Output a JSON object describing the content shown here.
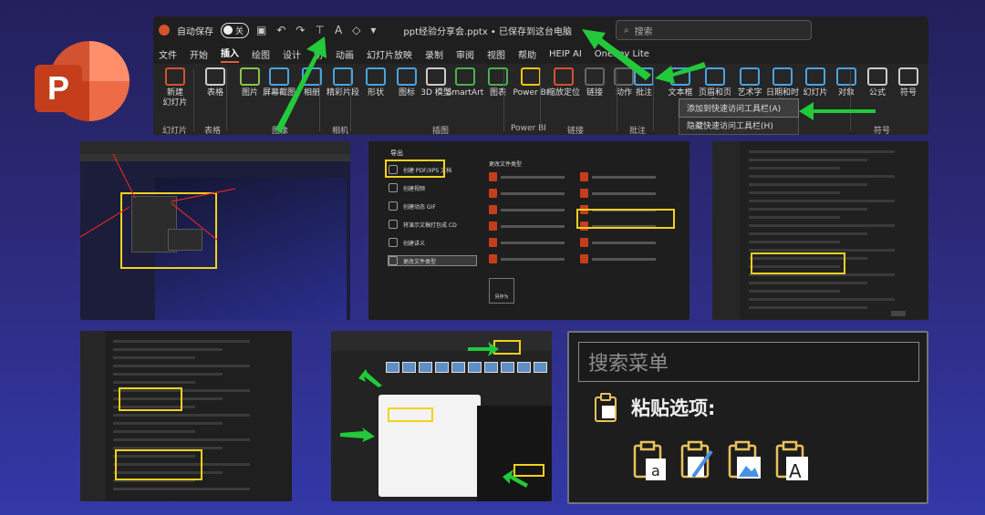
{
  "ribbon": {
    "autosave_label": "自动保存",
    "autosave_state": "关",
    "doc_title": "ppt经验分享会.pptx • 已保存到这台电脑",
    "search_placeholder": "搜索",
    "tabs": [
      "文件",
      "开始",
      "插入",
      "绘图",
      "设计",
      "切",
      "动画",
      "幻灯片放映",
      "录制",
      "审阅",
      "视图",
      "帮助",
      "HEIP AI",
      "OneKey Lite"
    ],
    "active_tab": "插入",
    "buttons": [
      {
        "label": "新建\n幻灯片",
        "icon": "new-slide-icon"
      },
      {
        "label": "表格",
        "icon": "table-icon"
      },
      {
        "label": "图片",
        "icon": "picture-icon"
      },
      {
        "label": "屏幕截图",
        "icon": "screenshot-icon"
      },
      {
        "label": "相册",
        "icon": "album-icon"
      },
      {
        "label": "精彩片段",
        "icon": "clips-icon"
      },
      {
        "label": "形状",
        "icon": "shapes-icon"
      },
      {
        "label": "图标",
        "icon": "icons-icon"
      },
      {
        "label": "3D 模型",
        "icon": "3d-model-icon"
      },
      {
        "label": "SmartArt",
        "icon": "smartart-icon"
      },
      {
        "label": "图表",
        "icon": "chart-icon"
      },
      {
        "label": "Power BI",
        "icon": "powerbi-icon"
      },
      {
        "label": "缩放定位",
        "icon": "zoom-icon"
      },
      {
        "label": "链接",
        "icon": "link-icon"
      },
      {
        "label": "动作",
        "icon": "action-icon"
      },
      {
        "label": "批注",
        "icon": "comment-icon"
      },
      {
        "label": "文本框",
        "icon": "textbox-icon"
      },
      {
        "label": "页眉和页脚",
        "icon": "header-footer-icon"
      },
      {
        "label": "艺术字",
        "icon": "wordart-icon"
      },
      {
        "label": "日期和时间",
        "icon": "datetime-icon"
      },
      {
        "label": "幻灯片",
        "icon": "slide-number-icon"
      },
      {
        "label": "对象",
        "icon": "object-icon"
      },
      {
        "label": "公式",
        "icon": "equation-icon"
      },
      {
        "label": "符号",
        "icon": "symbol-icon"
      }
    ],
    "group_labels": [
      "幻灯片",
      "表格",
      "图像",
      "相机",
      "插图",
      "Power BI",
      "链接",
      "批注",
      "符号"
    ],
    "context_menu": [
      "添加到快速访问工具栏(A)",
      "隐藏快速访问工具栏(H)"
    ]
  },
  "export_panel": {
    "title": "导出",
    "items": [
      "创建 PDF/XPS 文档",
      "创建视频",
      "创建动态 GIF",
      "将演示文稿打包成 CD",
      "创建讲义",
      "更改文件类型"
    ],
    "section": "更改文件类型",
    "save_as_label": "另存为"
  },
  "search_menu": {
    "placeholder": "搜索菜单",
    "paste_options": "粘贴选项:"
  },
  "colors": {
    "accent": "#e65b3b",
    "highlight_box": "#f2d21b",
    "arrow": "#22c93a",
    "red_arrow": "#e02424"
  }
}
